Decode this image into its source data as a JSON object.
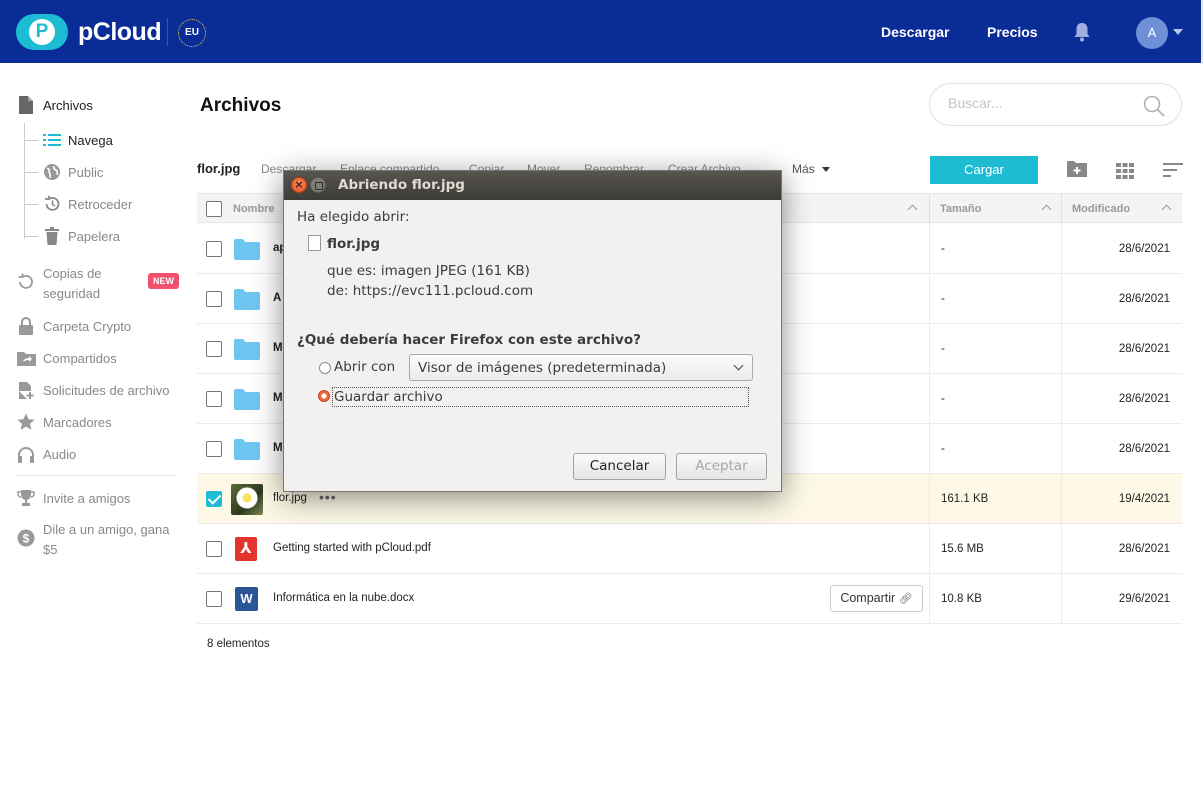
{
  "header": {
    "logo_text": "pCloud",
    "region_badge": "EU",
    "nav": [
      "Descargar",
      "Precios"
    ],
    "avatar_initial": "A"
  },
  "sidebar": {
    "files": "Archivos",
    "browse": "Navega",
    "public": "Public",
    "rewind": "Retroceder",
    "trash": "Papelera",
    "backups": "Copias de seguridad",
    "new_badge": "NEW",
    "crypto": "Carpeta Crypto",
    "shared": "Compartidos",
    "file_requests": "Solicitudes de archivo",
    "bookmarks": "Marcadores",
    "audio": "Audio",
    "invite": "Invite a amigos",
    "refer": "Dile a un amigo, gana $5"
  },
  "main": {
    "title": "Archivos",
    "search_placeholder": "Buscar...",
    "toolbar": {
      "selected_file": "flor.jpg",
      "actions": [
        "Descargar",
        "Enlace compartido",
        "Copiar",
        "Mover",
        "Renombrar",
        "Crear Archivo"
      ],
      "more": "Más",
      "upload": "Cargar"
    },
    "columns": {
      "name": "Nombre",
      "size": "Tamaño",
      "modified": "Modificado"
    },
    "rows": [
      {
        "name": "ap",
        "size": "-",
        "date": "28/6/2021",
        "type": "folder"
      },
      {
        "name": "A",
        "size": "-",
        "date": "28/6/2021",
        "type": "folder"
      },
      {
        "name": "M",
        "size": "-",
        "date": "28/6/2021",
        "type": "folder"
      },
      {
        "name": "M",
        "size": "-",
        "date": "28/6/2021",
        "type": "folder"
      },
      {
        "name": "M",
        "size": "-",
        "date": "28/6/2021",
        "type": "folder"
      },
      {
        "name": "flor.jpg",
        "size": "161.1 KB",
        "date": "19/4/2021",
        "type": "image",
        "checked": true
      },
      {
        "name": "Getting started with pCloud.pdf",
        "size": "15.6 MB",
        "date": "28/6/2021",
        "type": "pdf"
      },
      {
        "name": "Informática en la nube.docx",
        "size": "10.8 KB",
        "date": "29/6/2021",
        "type": "docx"
      }
    ],
    "share_button": "Compartir",
    "item_count": "8 elementos"
  },
  "dialog": {
    "title": "Abriendo flor.jpg",
    "intro": "Ha elegido abrir:",
    "filename": "flor.jpg",
    "type_line": "que es: imagen JPEG (161 KB)",
    "from_line": "de: https://evc111.pcloud.com",
    "question": "¿Qué debería hacer Firefox con este archivo?",
    "open_with_label": "Abrir con",
    "open_with_value": "Visor de imágenes (predeterminada)",
    "save_label": "Guardar archivo",
    "cancel": "Cancelar",
    "accept": "Aceptar"
  },
  "colors": {
    "header_bg": "#0a2c96",
    "accent": "#1dbcd3",
    "new_badge": "#f0506e",
    "selected_row": "#fdf9e6"
  }
}
